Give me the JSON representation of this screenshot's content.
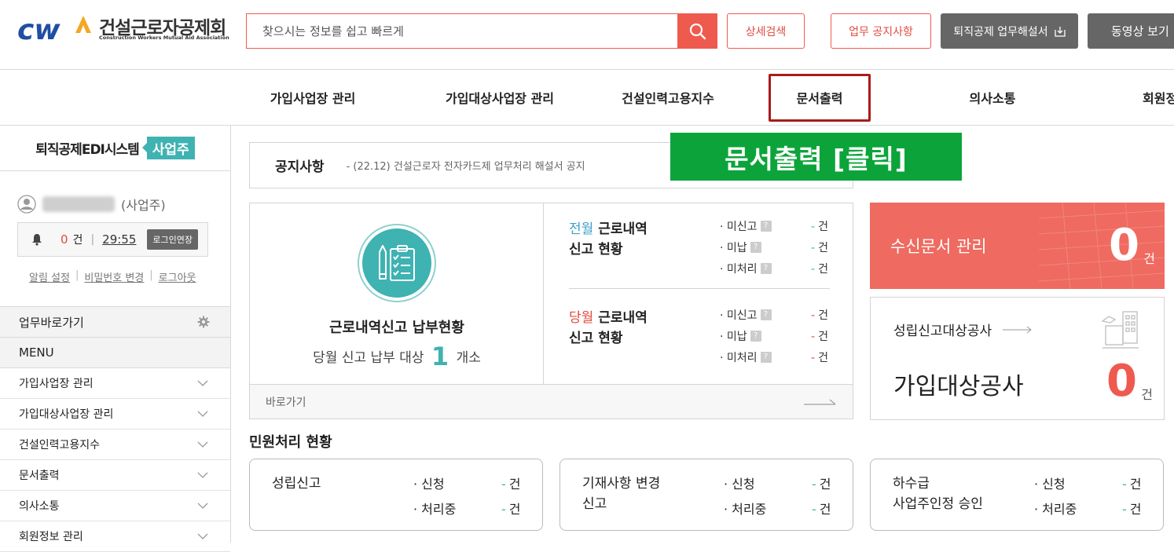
{
  "header": {
    "logo_name": "건설근로자공제회",
    "logo_sub": "Construction Workers Mutual Aid Association",
    "search_placeholder": "찾으시는 정보를 쉽고 빠르게",
    "detail_search": "상세검색",
    "notice_btn": "업무 공지사항",
    "manual_btn": "퇴직공제 업무해설서",
    "video_btn": "동영상 보기"
  },
  "nav": {
    "items": [
      "가입사업장 관리",
      "가입대상사업장 관리",
      "건설인력고용지수",
      "문서출력",
      "의사소통",
      "회원정"
    ]
  },
  "sidebar": {
    "system_title": "퇴직공제EDI시스템",
    "system_badge": "사업주",
    "user_role": "(사업주)",
    "alert_count": "0",
    "alert_unit": "건",
    "session_time": "29:55",
    "extend_btn": "로그인연장",
    "links": [
      "알림 설정",
      "비밀번호 변경",
      "로그아웃"
    ],
    "quick_label": "업무바로가기",
    "menu_label": "MENU",
    "menu_items": [
      "가입사업장 관리",
      "가입대상사업장 관리",
      "건설인력고용지수",
      "문서출력",
      "의사소통",
      "회원정보 관리"
    ]
  },
  "notice": {
    "label": "공지사항",
    "text": "- (22.12) 건설근로자 전자카드제 업무처리 해설서 공지"
  },
  "annotation": {
    "banner": "문서출력 [클릭]",
    "color": "#0ca43a"
  },
  "report": {
    "title": "근로내역신고 납부현황",
    "sub_prefix": "당월 신고 납부 대상",
    "count": "1",
    "sub_suffix": "개소",
    "prev": {
      "hl": "전월",
      "rest": " 근로내역",
      "line2": "신고 현황"
    },
    "curr": {
      "hl": "당월",
      "rest": " 근로내역",
      "line2": "신고 현황"
    },
    "stat_labels": [
      "· 미신고",
      "· 미납",
      "· 미처리"
    ],
    "stat_value": "-",
    "stat_unit": "건",
    "help_mark": "?",
    "link": "바로가기"
  },
  "received": {
    "title": "수신문서 관리",
    "count": "0",
    "unit": "건"
  },
  "target": {
    "small": "성립신고대상공사",
    "big": "가입대상공사",
    "count": "0",
    "unit": "건"
  },
  "petition": {
    "title": "민원처리 현황",
    "row_labels": [
      "· 신청",
      "· 처리중"
    ],
    "value": "-",
    "unit": "건",
    "cards": [
      {
        "line1": "성립신고",
        "line2": ""
      },
      {
        "line1": "기재사항 변경",
        "line2": "신고"
      },
      {
        "line1": "하수급",
        "line2": "사업주인정 승인"
      }
    ]
  },
  "colors": {
    "accent": "#ef5a4f",
    "teal": "#3fb2b2",
    "highlight_border": "#a81c1c"
  }
}
